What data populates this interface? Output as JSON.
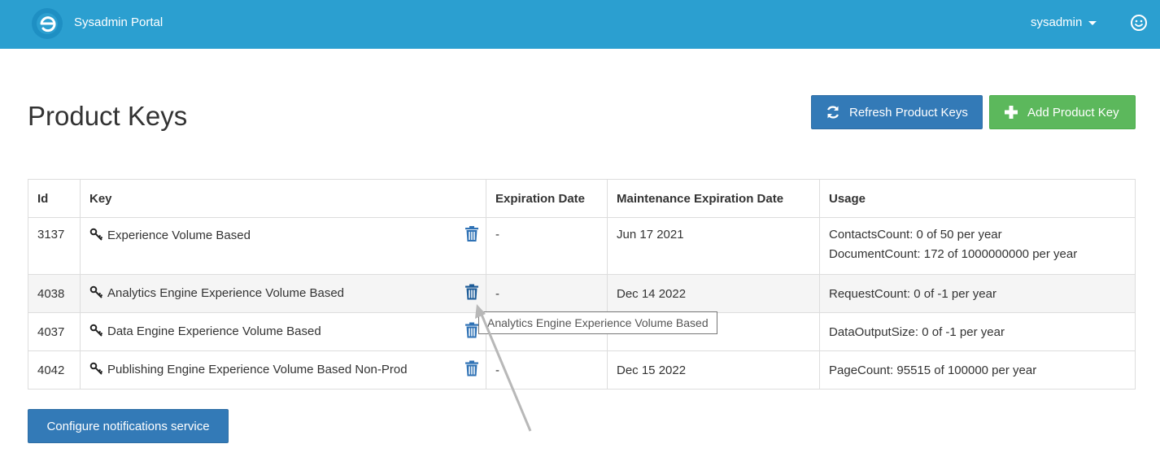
{
  "header": {
    "app_title": "Sysadmin Portal",
    "user_label": "sysadmin",
    "brand_color": "#2b9fd0"
  },
  "page": {
    "title": "Product Keys"
  },
  "actions": {
    "refresh_label": "Refresh Product Keys",
    "add_label": "Add Product Key",
    "configure_label": "Configure notifications service"
  },
  "table": {
    "columns": [
      "Id",
      "Key",
      "Expiration Date",
      "Maintenance Expiration Date",
      "Usage"
    ],
    "rows": [
      {
        "id": "3137",
        "key": "Experience Volume Based",
        "expiration": "-",
        "maintenance": "Jun 17 2021",
        "usage": [
          "ContactsCount: 0 of 50 per year",
          "DocumentCount: 172 of 1000000000 per year"
        ]
      },
      {
        "id": "4038",
        "key": "Analytics Engine Experience Volume Based",
        "expiration": "-",
        "maintenance": "Dec 14 2022",
        "usage": [
          "RequestCount: 0 of -1 per year"
        ]
      },
      {
        "id": "4037",
        "key": "Data Engine Experience Volume Based",
        "expiration": "",
        "maintenance": "",
        "usage": [
          "DataOutputSize: 0 of -1 per year"
        ]
      },
      {
        "id": "4042",
        "key": "Publishing Engine Experience Volume Based Non-Prod",
        "expiration": "-",
        "maintenance": "Dec 15 2022",
        "usage": [
          "PageCount: 95515 of 100000 per year"
        ]
      }
    ]
  },
  "tooltip": {
    "text": "Analytics Engine Experience Volume Based"
  },
  "icons": {
    "logo": "brand-logo-icon",
    "user_caret": "chevron-down-icon",
    "smiley": "smiley-icon",
    "refresh": "refresh-icon",
    "add": "plus-icon",
    "key": "key-icon",
    "delete": "trash-icon"
  }
}
